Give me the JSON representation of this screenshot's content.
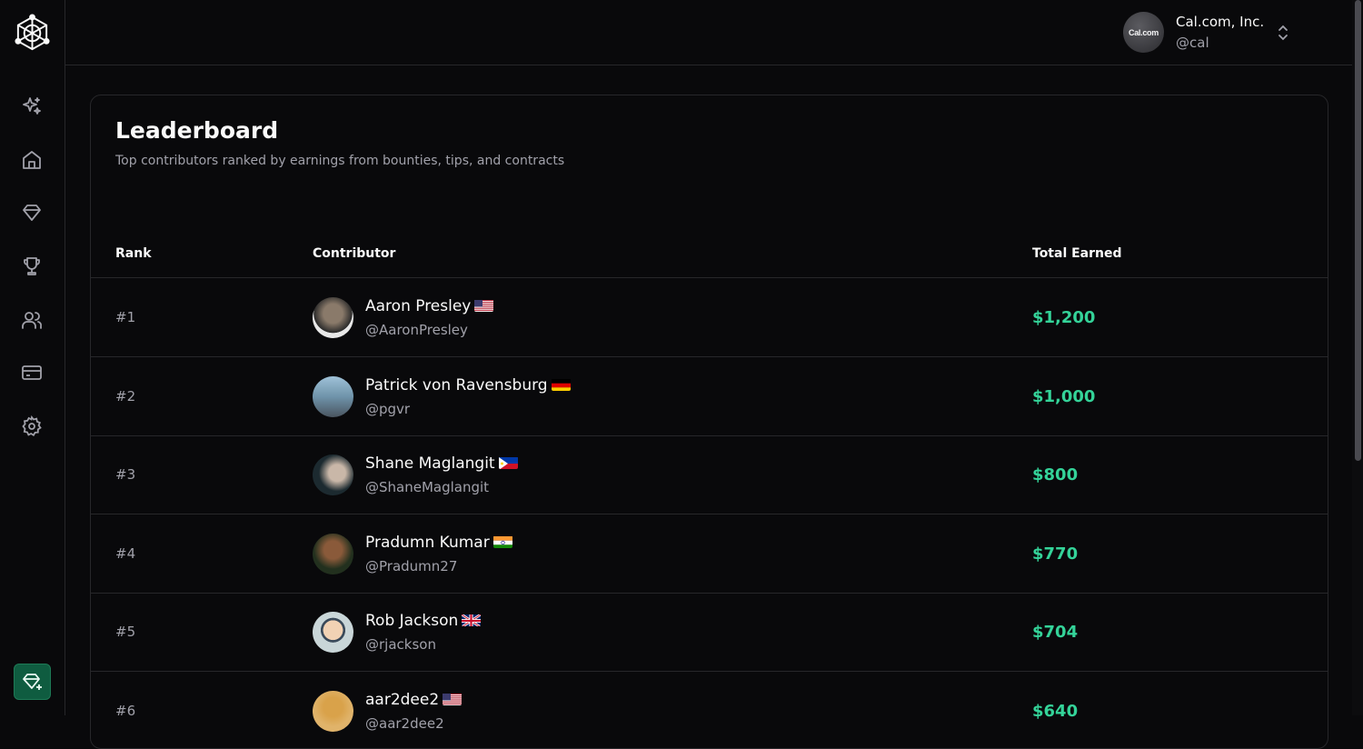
{
  "org": {
    "name": "Cal.com, Inc.",
    "handle": "@cal",
    "avatar_text": "Cal.com"
  },
  "nav": [
    {
      "icon": "sparkles-icon"
    },
    {
      "icon": "home-icon"
    },
    {
      "icon": "tag-icon"
    },
    {
      "icon": "trophy-icon"
    },
    {
      "icon": "users-icon"
    },
    {
      "icon": "credit-card-icon"
    },
    {
      "icon": "gear-icon"
    }
  ],
  "page": {
    "title": "Leaderboard",
    "subtitle": "Top contributors ranked by earnings from bounties, tips, and contracts"
  },
  "table": {
    "headers": {
      "rank": "Rank",
      "contributor": "Contributor",
      "total": "Total Earned"
    },
    "rows": [
      {
        "rank": "#1",
        "name": "Aaron Presley",
        "flag": "US",
        "handle": "@AaronPresley",
        "total": "$1,200"
      },
      {
        "rank": "#2",
        "name": "Patrick von Ravensburg",
        "flag": "DE",
        "handle": "@pgvr",
        "total": "$1,000"
      },
      {
        "rank": "#3",
        "name": "Shane Maglangit",
        "flag": "PH",
        "handle": "@ShaneMaglangit",
        "total": "$800"
      },
      {
        "rank": "#4",
        "name": "Pradumn Kumar",
        "flag": "IN",
        "handle": "@Pradumn27",
        "total": "$770"
      },
      {
        "rank": "#5",
        "name": "Rob Jackson",
        "flag": "GB",
        "handle": "@rjackson",
        "total": "$704"
      },
      {
        "rank": "#6",
        "name": "aar2dee2",
        "flag": "US",
        "handle": "@aar2dee2",
        "total": "$640"
      }
    ]
  },
  "colors": {
    "accent": "#34d399",
    "background": "#09090b",
    "border": "#27272a",
    "muted": "#a1a1aa"
  }
}
